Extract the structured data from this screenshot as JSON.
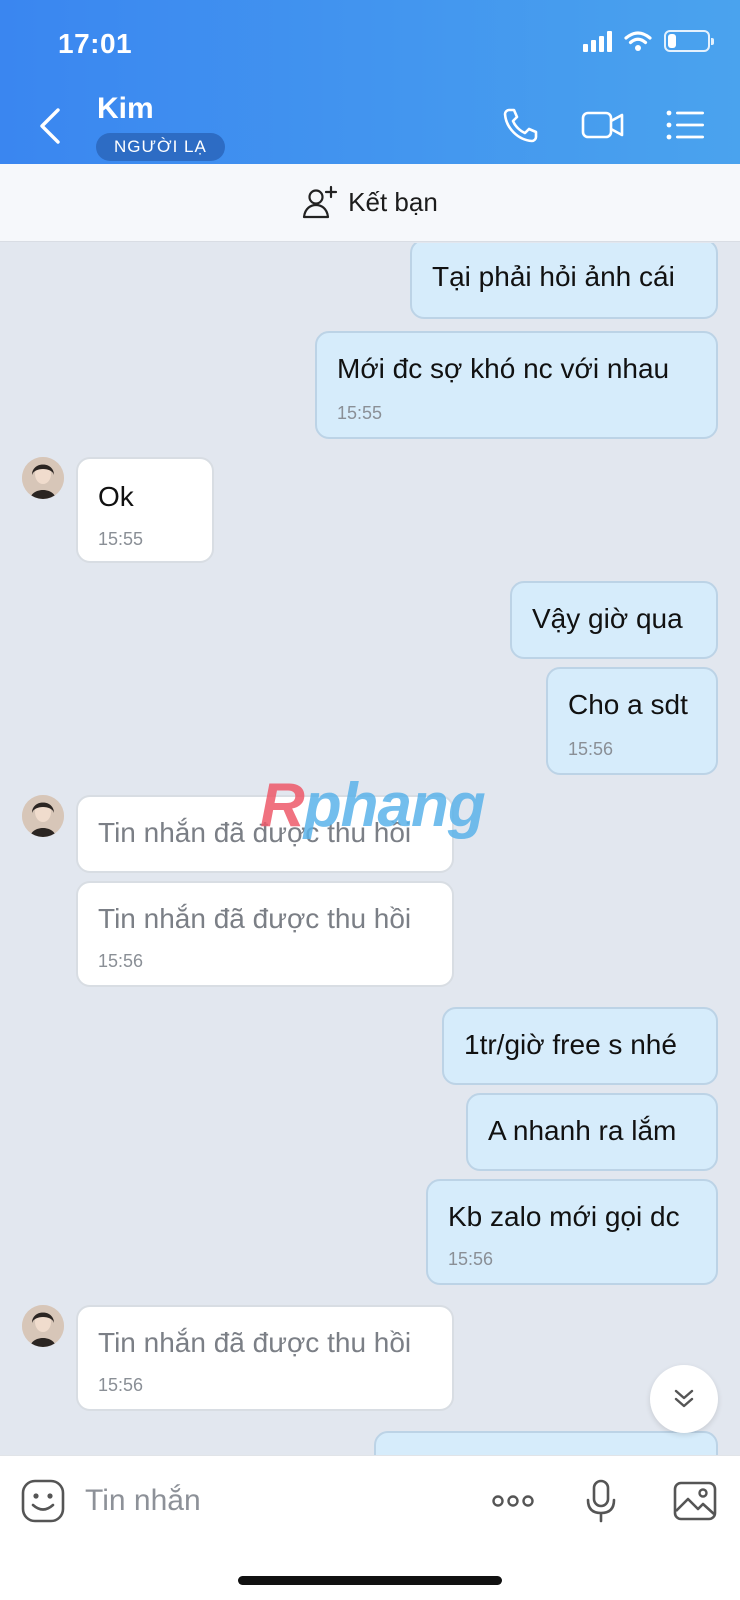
{
  "status_bar": {
    "time": "17:01"
  },
  "header": {
    "contact_name": "Kim",
    "badge": "NGƯỜI LẠ"
  },
  "add_friend": {
    "label": "Kết bạn"
  },
  "messages": [
    {
      "dir": "out",
      "text": "Tại phải hỏi ảnh cái",
      "time": ""
    },
    {
      "dir": "out",
      "text": "Mới đc sợ khó nc với nhau",
      "time": "15:55"
    },
    {
      "dir": "in",
      "text": "Ok",
      "time": "15:55"
    },
    {
      "dir": "out",
      "text": "Vậy giờ qua",
      "time": ""
    },
    {
      "dir": "out",
      "text": "Cho a sdt",
      "time": "15:56"
    },
    {
      "dir": "in",
      "text": "Tin nhắn đã được thu hồi",
      "time": ""
    },
    {
      "dir": "in",
      "text": "Tin nhắn đã được thu hồi",
      "time": "15:56"
    },
    {
      "dir": "out",
      "text": "1tr/giờ free s nhé",
      "time": ""
    },
    {
      "dir": "out",
      "text": "A nhanh ra lắm",
      "time": ""
    },
    {
      "dir": "out",
      "text": "Kb zalo mới gọi dc",
      "time": "15:56"
    },
    {
      "dir": "in",
      "text": "Tin nhắn đã được thu hồi",
      "time": "15:56"
    }
  ],
  "watermark": {
    "part1": "R",
    "part2": "phang"
  },
  "input": {
    "placeholder": "Tin nhắn"
  },
  "icons": {
    "back": "chevron-left-icon",
    "call": "phone-icon",
    "video": "video-camera-icon",
    "menu": "list-menu-icon",
    "add_friend": "add-user-icon",
    "sticker": "sticker-smiley-icon",
    "more": "more-dots-icon",
    "mic": "microphone-icon",
    "gallery": "image-gallery-icon",
    "scroll": "chevron-double-down-icon"
  },
  "colors": {
    "header_start": "#3a86f0",
    "header_end": "#4aa3ee",
    "outgoing_bubble": "#d6ecfb",
    "incoming_bubble": "#ffffff",
    "chat_background": "#e2e7ef"
  }
}
